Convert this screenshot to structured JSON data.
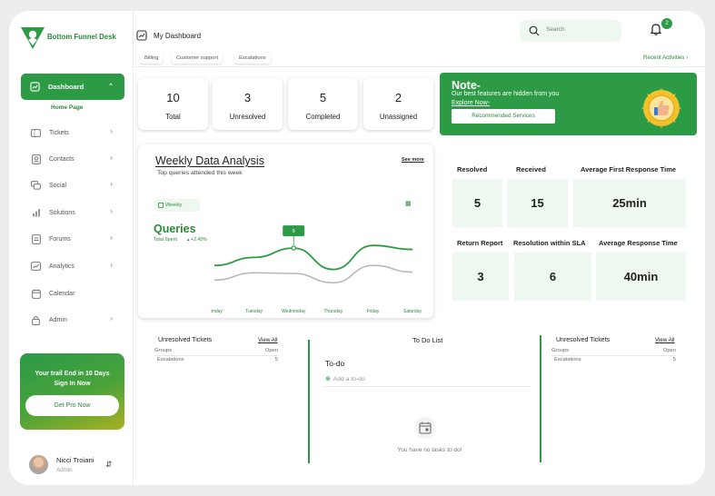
{
  "brand": {
    "name": "Bottom Funnel Desk",
    "color": "#2d9b45"
  },
  "sidebar": {
    "active": {
      "label": "Dashboard",
      "sub": "Home Page"
    },
    "items": [
      {
        "label": "Tickets",
        "icon": "ticket-icon"
      },
      {
        "label": "Contacts",
        "icon": "contacts-icon"
      },
      {
        "label": "Social",
        "icon": "chat-icon"
      },
      {
        "label": "Solutions",
        "icon": "bar-chart-icon"
      },
      {
        "label": "Forums",
        "icon": "document-icon"
      },
      {
        "label": "Analytics",
        "icon": "analytics-icon"
      },
      {
        "label": "Calendar",
        "icon": "calendar-icon"
      },
      {
        "label": "Admin",
        "icon": "lock-icon"
      }
    ],
    "promo": {
      "message": "Your trail End in 10 Days Sign In Now",
      "button": "Get Pro Now"
    },
    "user": {
      "name": "Nicci Troiani",
      "role": "Admin"
    }
  },
  "header": {
    "title": "My Dashboard",
    "tabs": [
      "Billing",
      "Customer support",
      "Escalations"
    ],
    "search_placeholder": "Search",
    "notification_count": "2",
    "recent_link": "Recent Activities"
  },
  "stats": [
    {
      "value": "10",
      "label": "Total"
    },
    {
      "value": "3",
      "label": "Unresolved"
    },
    {
      "value": "5",
      "label": "Completed"
    },
    {
      "value": "2",
      "label": "Unassigned"
    }
  ],
  "note": {
    "heading": "Note-",
    "text": "Our best features are hidden from you",
    "link": "Explore Now-",
    "button": "Recommended Services"
  },
  "weekly": {
    "title": "Weekly Data Analysis",
    "subtitle": "Top queries attended this week",
    "see_more": "See more",
    "filter": "Weekly",
    "metric": "Queries",
    "metric_sub": "Total Spent",
    "change": "+2.45%"
  },
  "chart_data": {
    "type": "line",
    "categories": [
      "Monday",
      "Tuesday",
      "Wednesday",
      "Thursday",
      "Friday",
      "Saturday"
    ],
    "series": [
      {
        "values": [
          4.2,
          5.4,
          6.8,
          3.6,
          7.2,
          6.6
        ],
        "color": "#2d9b45"
      },
      {
        "values": [
          2.0,
          3.1,
          3.0,
          1.6,
          4.2,
          3.2
        ],
        "color": "#b8b8b8"
      }
    ],
    "tooltip": {
      "label": "9",
      "category_index": 2
    },
    "grid": false
  },
  "metrics": {
    "row1": [
      {
        "label": "Resolved",
        "value": "5"
      },
      {
        "label": "Received",
        "value": "15"
      },
      {
        "label": "Average First Response Time",
        "value": "25min"
      }
    ],
    "row2": [
      {
        "label": "Return Report",
        "value": "3"
      },
      {
        "label": "Resolution within SLA",
        "value": "6"
      },
      {
        "label": "Average Response Time",
        "value": "40min"
      }
    ]
  },
  "unresolved_left": {
    "title": "Unresolved Tickets",
    "view_all": "View All",
    "head_key": "Groups",
    "head_val": "Open",
    "row_key": "Escalations",
    "row_val": "5"
  },
  "unresolved_right": {
    "title": "Unresolved Tickets",
    "view_all": "View All",
    "head_key": "Groups",
    "head_val": "Open",
    "row_key": "Escalations",
    "row_val": "5"
  },
  "todo": {
    "title": "To Do List",
    "subtitle": "To-do",
    "add": "Add a to-do",
    "empty": "You have no tasks to do!"
  }
}
